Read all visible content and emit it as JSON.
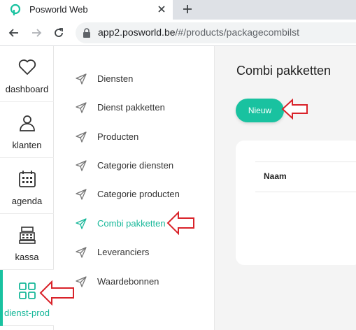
{
  "browser": {
    "tab_title": "Posworld Web",
    "url_host": "app2.posworld.be",
    "url_path": "/#/products/packagecombilst"
  },
  "leftnav": {
    "items": [
      {
        "label": "dashboard",
        "icon": "heart-icon"
      },
      {
        "label": "klanten",
        "icon": "user-icon"
      },
      {
        "label": "agenda",
        "icon": "calendar-icon"
      },
      {
        "label": "kassa",
        "icon": "cash-register-icon"
      },
      {
        "label": "dienst-prod",
        "icon": "grid-icon",
        "active": true
      }
    ]
  },
  "submenu": {
    "items": [
      {
        "label": "Diensten"
      },
      {
        "label": "Dienst pakketten"
      },
      {
        "label": "Producten"
      },
      {
        "label": "Categorie diensten"
      },
      {
        "label": "Categorie producten"
      },
      {
        "label": "Combi pakketten",
        "active": true
      },
      {
        "label": "Leveranciers"
      },
      {
        "label": "Waardebonnen"
      }
    ]
  },
  "main": {
    "title": "Combi pakketten",
    "new_button": "Nieuw",
    "table_headers": [
      "Naam"
    ]
  },
  "colors": {
    "accent": "#19c2a0",
    "annotation_arrow": "#d9232a"
  }
}
